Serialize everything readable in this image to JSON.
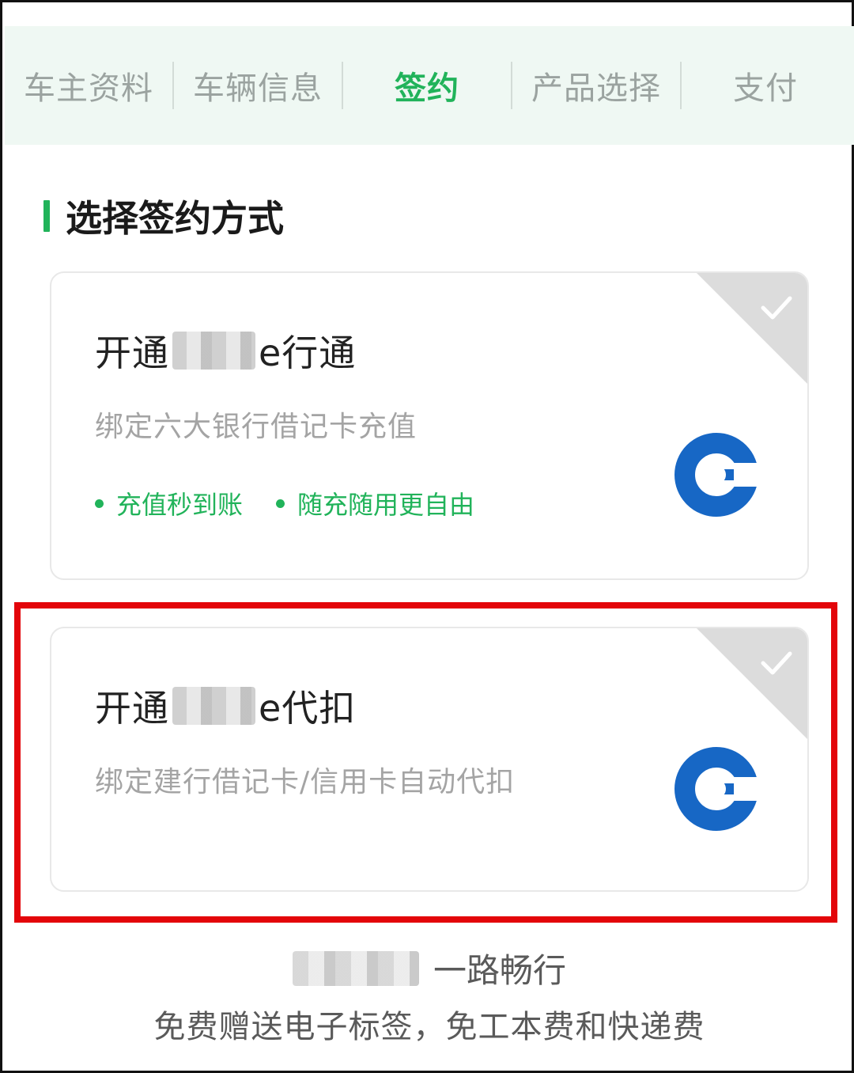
{
  "steps": [
    {
      "label": "车主资料",
      "active": false
    },
    {
      "label": "车辆信息",
      "active": false
    },
    {
      "label": "签约",
      "active": true
    },
    {
      "label": "产品选择",
      "active": false
    },
    {
      "label": "支付",
      "active": false
    }
  ],
  "section": {
    "title": "选择签约方式"
  },
  "cards": [
    {
      "title_prefix": "开通",
      "title_suffix": "e行通",
      "description": "绑定六大银行借记卡充值",
      "features": [
        "充值秒到账",
        "随充随用更自由"
      ]
    },
    {
      "title_prefix": "开通",
      "title_suffix": "e代扣",
      "description": "绑定建行借记卡/信用卡自动代扣",
      "features": []
    }
  ],
  "footer": {
    "promo_text": "一路畅行",
    "subtext": "免费赠送电子标签，免工本费和快递费"
  },
  "colors": {
    "accent": "#21b35a",
    "highlight": "#e3050a",
    "bank_blue": "#1767c5"
  },
  "icons": {
    "selection": "check-icon",
    "bank": "ccb-logo-icon"
  }
}
